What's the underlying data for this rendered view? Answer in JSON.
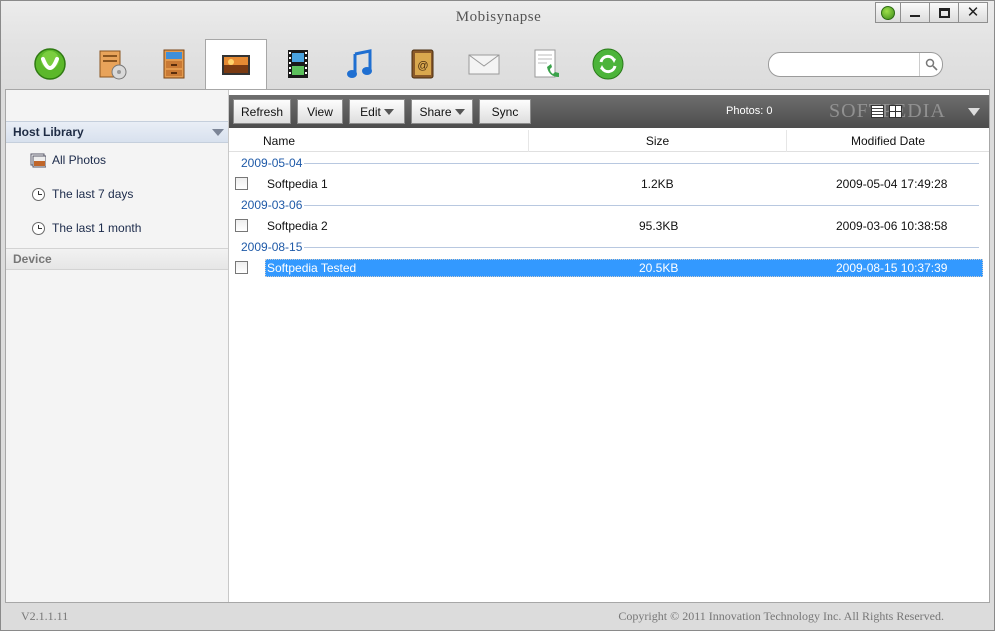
{
  "app": {
    "title": "Mobisynapse",
    "version": "V2.1.1.11",
    "copyright": "Copyright © 2011 Innovation Technology Inc. All Rights Reserved."
  },
  "window_controls": [
    "app-logo",
    "minimize",
    "maximize",
    "close"
  ],
  "toolbar": {
    "items": [
      {
        "name": "home",
        "icon": "mobisynapse-logo-icon"
      },
      {
        "name": "applications",
        "icon": "app-box-icon"
      },
      {
        "name": "files",
        "icon": "file-cabinet-icon"
      },
      {
        "name": "photos",
        "icon": "photo-icon",
        "active": true
      },
      {
        "name": "videos",
        "icon": "film-icon"
      },
      {
        "name": "music",
        "icon": "music-note-icon"
      },
      {
        "name": "contacts",
        "icon": "address-book-icon"
      },
      {
        "name": "messages",
        "icon": "envelope-icon"
      },
      {
        "name": "calls",
        "icon": "call-log-icon"
      },
      {
        "name": "sync",
        "icon": "sync-arrows-icon"
      }
    ]
  },
  "search": {
    "placeholder": "",
    "value": ""
  },
  "sidebar": {
    "host_library": "Host Library",
    "items": [
      {
        "label": "All Photos",
        "icon": "photos-icon"
      },
      {
        "label": "The last 7 days",
        "icon": "clock-icon"
      },
      {
        "label": "The last 1 month",
        "icon": "clock-icon"
      }
    ],
    "device": "Device"
  },
  "actions": {
    "refresh": "Refresh",
    "view": "View",
    "edit": "Edit",
    "share": "Share",
    "sync": "Sync",
    "photos_count": "Photos: 0",
    "watermark": "SOFTPEDIA"
  },
  "columns": {
    "name": "Name",
    "size": "Size",
    "modified": "Modified Date"
  },
  "groups": [
    {
      "date": "2009-05-04",
      "rows": [
        {
          "name": "Softpedia 1",
          "size": "1.2KB",
          "modified": "2009-05-04 17:49:28"
        }
      ]
    },
    {
      "date": "2009-03-06",
      "rows": [
        {
          "name": "Softpedia 2",
          "size": "95.3KB",
          "modified": "2009-03-06 10:38:58"
        }
      ]
    },
    {
      "date": "2009-08-15",
      "rows": [
        {
          "name": "Softpedia Tested",
          "size": "20.5KB",
          "modified": "2009-08-15 10:37:39",
          "selected": true
        }
      ]
    }
  ],
  "colors": {
    "selection": "#3399ff",
    "group_label": "#1f5aa8",
    "action_bar": "#5a5a5a"
  }
}
